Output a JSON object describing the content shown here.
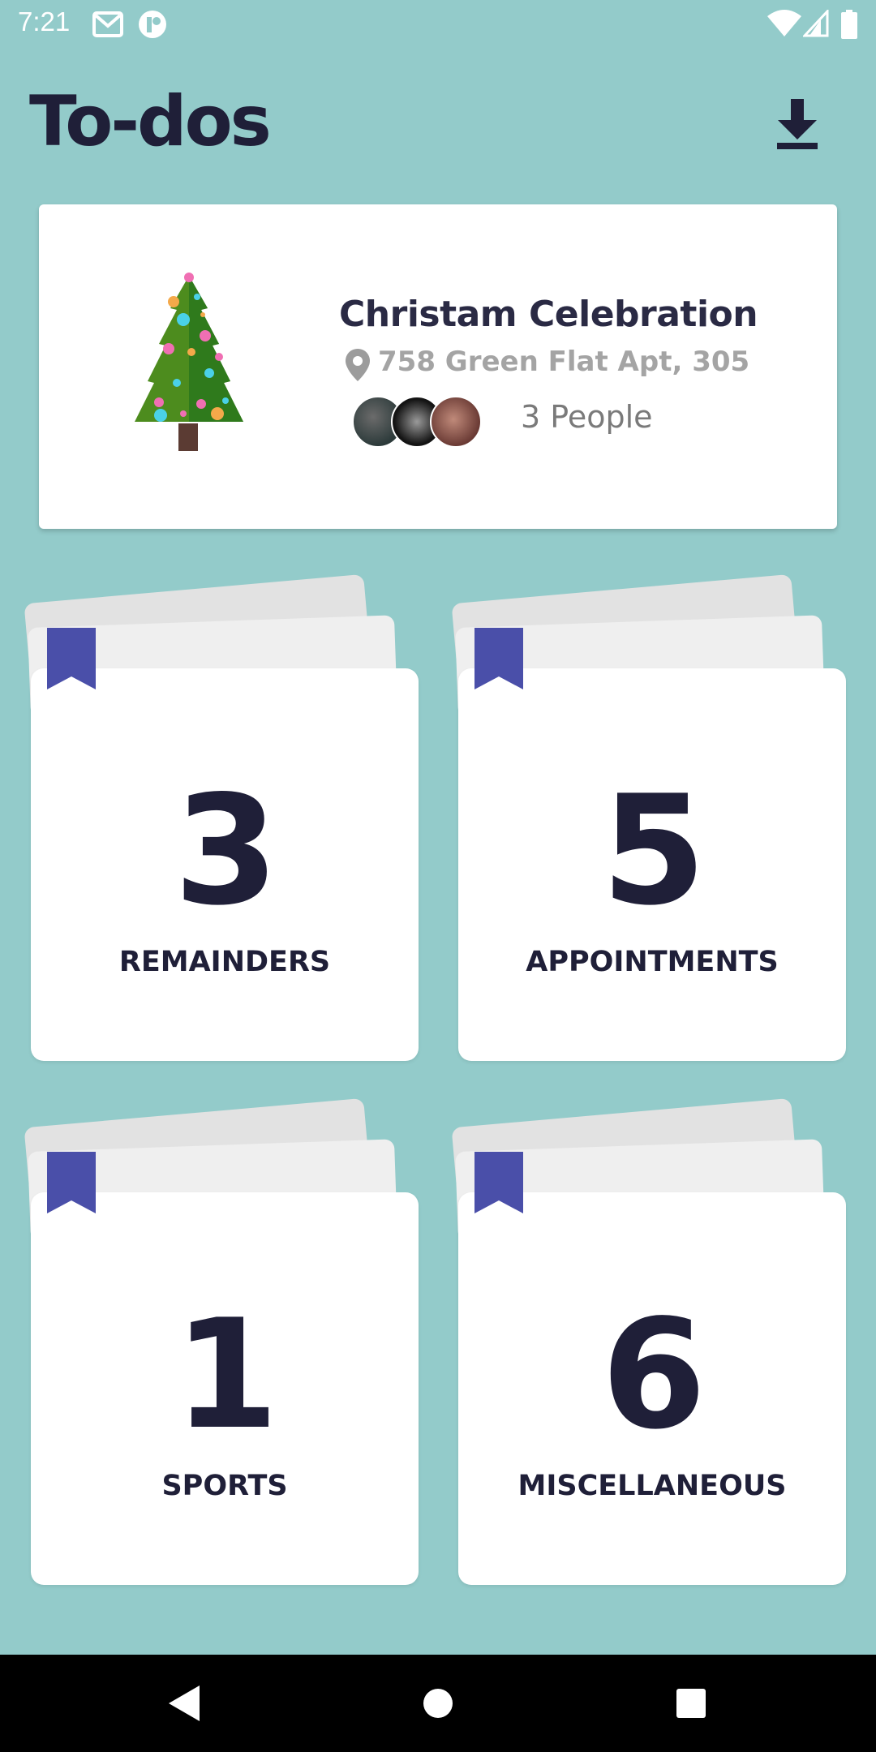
{
  "status_bar": {
    "time": "7:21",
    "icons": [
      "gmail-icon",
      "app-icon",
      "wifi-icon",
      "signal-icon",
      "battery-icon"
    ]
  },
  "header": {
    "title": "To-dos",
    "download_icon": "download-icon"
  },
  "event": {
    "title": "Christam Celebration",
    "address": "758 Green Flat Apt, 305",
    "people": "3 People",
    "icon": "christmas-tree-icon"
  },
  "tiles": [
    {
      "count": "3",
      "label": "REMAINDERS"
    },
    {
      "count": "5",
      "label": "APPOINTMENTS"
    },
    {
      "count": "1",
      "label": "SPORTS"
    },
    {
      "count": "6",
      "label": "MISCELLANEOUS"
    }
  ],
  "colors": {
    "background": "#93cbca",
    "bookmark": "#4a4fa9",
    "text_dark": "#1f1f38"
  },
  "nav": [
    "back-icon",
    "home-icon",
    "recents-icon"
  ]
}
